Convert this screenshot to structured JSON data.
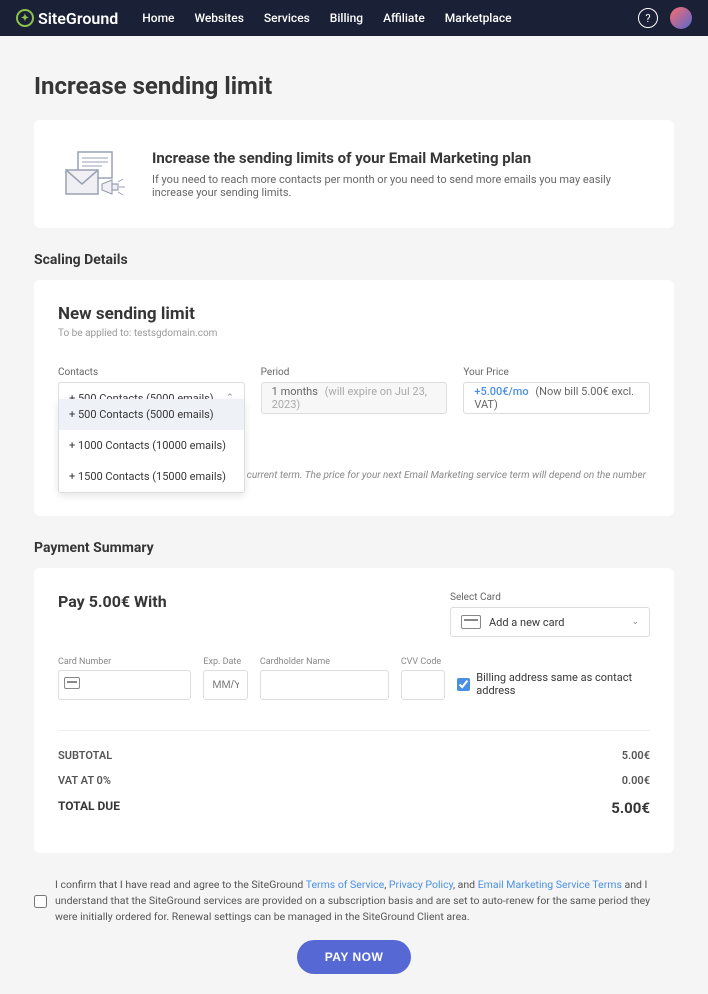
{
  "brand": "SiteGround",
  "nav": [
    "Home",
    "Websites",
    "Services",
    "Billing",
    "Affiliate",
    "Marketplace"
  ],
  "page_title": "Increase sending limit",
  "intro": {
    "heading": "Increase the sending limits of your Email Marketing plan",
    "body": "If you need to reach more contacts per month or you need to send more emails you may easily increase your sending limits."
  },
  "scaling": {
    "section_title": "Scaling Details",
    "title": "New sending limit",
    "applied_prefix": "To be applied to: ",
    "applied_domain": "testsgdomain.com",
    "contacts_label": "Contacts",
    "period_label": "Period",
    "price_label": "Your Price",
    "contacts_selected": "+ 500 Contacts (5000 emails)",
    "contacts_options": [
      "+ 500 Contacts (5000 emails)",
      "+ 1000 Contacts (10000 emails)",
      "+ 1500 Contacts (15000 emails)"
    ],
    "period_value": "1 months",
    "period_note": "(will expire on Jul 23, 2023)",
    "price_value": "+5.00€/mo",
    "price_note": "(Now bill 5.00€ excl. VAT)",
    "footnote": "* The purchased upgrade will apply for your current term. The price for your next Email Marketing service term will depend on the number of contacts it includes."
  },
  "payment": {
    "section_title": "Payment Summary",
    "pay_with": "Pay 5.00€ With",
    "select_card_label": "Select Card",
    "select_card_value": "Add a new card",
    "cc": {
      "number_label": "Card Number",
      "exp_label": "Exp. Date",
      "exp_placeholder": "MM/YY",
      "holder_label": "Cardholder Name",
      "cvv_label": "CVV Code",
      "billing_same": "Billing address same as contact address"
    },
    "totals": {
      "subtotal_label": "SUBTOTAL",
      "subtotal_value": "5.00€",
      "vat_label": "VAT AT 0%",
      "vat_value": "0.00€",
      "due_label": "TOTAL DUE",
      "due_value": "5.00€"
    },
    "confirm": {
      "pre": "I confirm that I have read and agree to the SiteGround ",
      "tos": "Terms of Service",
      "sep1": ", ",
      "privacy": "Privacy Policy",
      "sep2": ", and ",
      "email_terms": "Email Marketing Service Terms",
      "post": " and I understand that the SiteGround services are provided on a subscription basis and are set to auto-renew for the same period they were initially ordered for. Renewal settings can be managed in the SiteGround Client area."
    },
    "pay_button": "PAY NOW"
  }
}
